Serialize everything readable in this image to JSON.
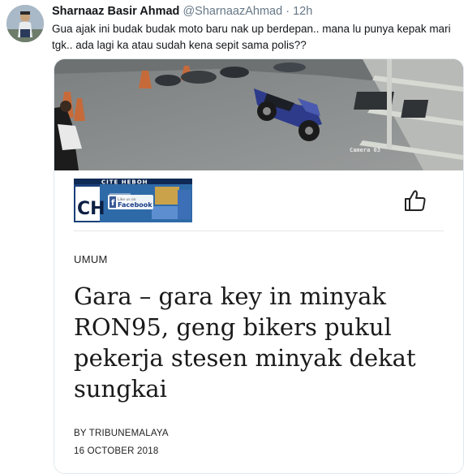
{
  "tweet": {
    "author_name": "Sharnaaz Basir Ahmad",
    "handle": "@SharnaazAhmad",
    "separator": "·",
    "time": "12h",
    "text": "Gua ajak ini budak budak moto baru nak up berdepan.. mana lu punya kepak mari tgk.. ada lagi ka atau sudah kena sepit sama polis??"
  },
  "card": {
    "media": {
      "camera_label": "Camera 03"
    },
    "logo": {
      "brand_text": "CITE HEBOH",
      "facebook_prompt": "Like us on",
      "facebook_text": "Facebook",
      "monogram": "CH"
    },
    "icons": {
      "like": "thumbs-up-icon"
    },
    "category": "UMUM",
    "headline": "Gara – gara key in minyak RON95, geng bikers pukul pekerja stesen minyak dekat sungkai",
    "byline": "BY TRIBUNEMALAYA",
    "date": "16 OCTOBER 2018"
  },
  "colors": {
    "name": "#14171a",
    "meta": "#657786",
    "border": "#e1e8ed"
  }
}
